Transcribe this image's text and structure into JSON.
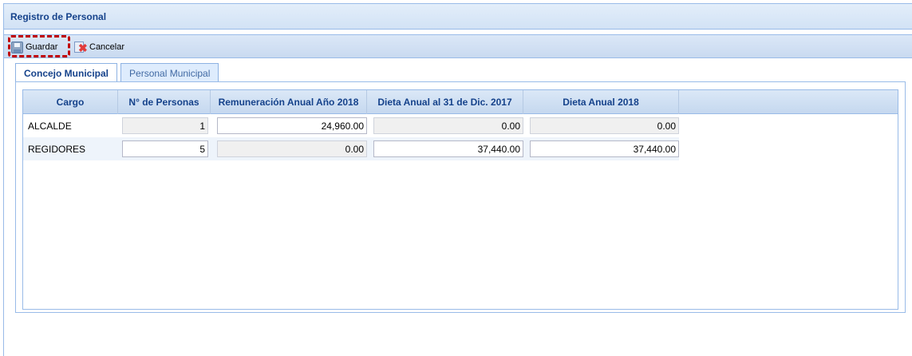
{
  "window": {
    "title": "Registro de Personal"
  },
  "toolbar": {
    "save_label": "Guardar",
    "cancel_label": "Cancelar"
  },
  "tabs": [
    {
      "label": "Concejo Municipal",
      "active": true
    },
    {
      "label": "Personal Municipal",
      "active": false
    }
  ],
  "grid": {
    "columns": [
      "Cargo",
      "N° de Personas",
      "Remuneración Anual Año 2018",
      "Dieta Anual al 31 de Dic. 2017",
      "Dieta Anual 2018"
    ],
    "rows": [
      {
        "cargo": "ALCALDE",
        "personas": "1",
        "remuneracion": "24,960.00",
        "dieta_2017": "0.00",
        "dieta_2018": "0.00"
      },
      {
        "cargo": "REGIDORES",
        "personas": "5",
        "remuneracion": "0.00",
        "dieta_2017": "37,440.00",
        "dieta_2018": "37,440.00"
      }
    ]
  },
  "colors": {
    "accent": "#15428b",
    "highlight": "#c00000",
    "header_bg": "#d2e2f5"
  },
  "icons": {
    "save": "save-disk-icon",
    "cancel": "cancel-icon"
  }
}
